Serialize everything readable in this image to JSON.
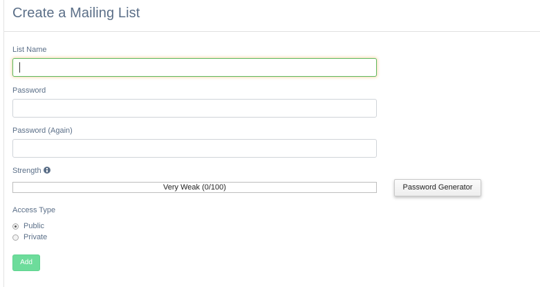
{
  "page": {
    "title": "Create a Mailing List"
  },
  "form": {
    "list_name": {
      "label": "List Name",
      "value": "",
      "placeholder": ""
    },
    "password": {
      "label": "Password",
      "value": "",
      "placeholder": ""
    },
    "password_again": {
      "label": "Password (Again)",
      "value": "",
      "placeholder": ""
    },
    "strength": {
      "label": "Strength",
      "text": "Very Weak (0/100)",
      "score": 0,
      "max": 100,
      "info_icon": "info-circle-icon"
    },
    "password_generator_label": "Password Generator",
    "access_type": {
      "label": "Access Type",
      "options": [
        {
          "label": "Public",
          "checked": true
        },
        {
          "label": "Private",
          "checked": false
        }
      ]
    },
    "add_label": "Add"
  },
  "colors": {
    "label_text": "#5b6f88",
    "focus_border": "#5cb85c",
    "add_button_bg": "#6ddc9b"
  }
}
